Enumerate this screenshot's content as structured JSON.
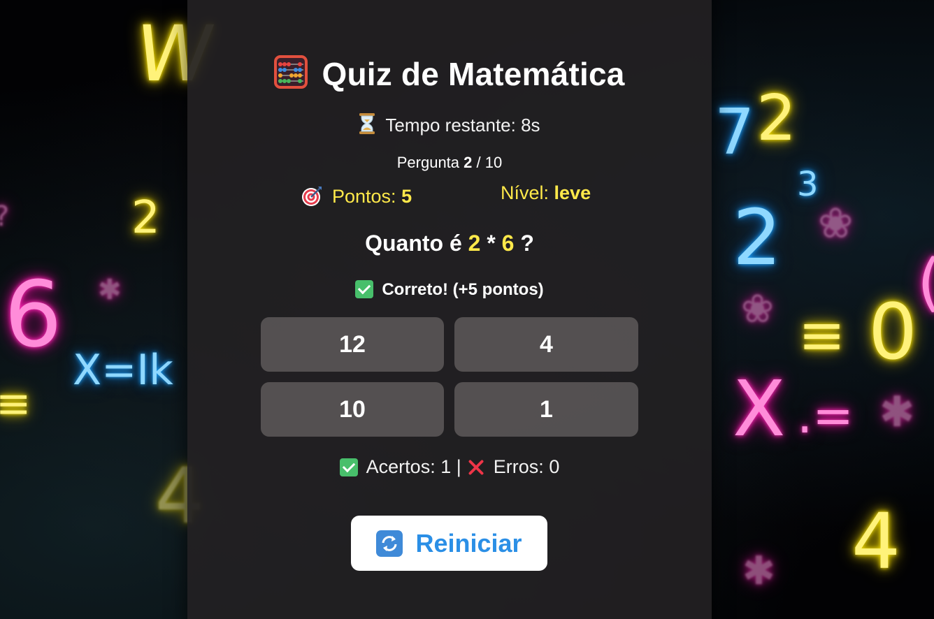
{
  "quiz": {
    "title": "Quiz de Matemática",
    "timer": {
      "label": "Tempo restante:",
      "value": "8s"
    },
    "progress": {
      "label": "Pergunta",
      "current": "2",
      "separator": "/",
      "total": "10"
    },
    "score": {
      "label": "Pontos:",
      "value": "5"
    },
    "level": {
      "label": "Nível:",
      "value": "leve"
    },
    "question": {
      "prefix": "Quanto é",
      "operand_a": "2",
      "operator": "*",
      "operand_b": "6",
      "suffix": "?"
    },
    "feedback": "Correto! (+5 pontos)",
    "answers": [
      "12",
      "4",
      "10",
      "1"
    ],
    "stats": {
      "hits_label": "Acertos:",
      "hits": "1",
      "separator": "|",
      "errors_label": "Erros:",
      "errors": "0"
    },
    "restart_label": "Reiniciar"
  },
  "icons": {
    "title": "abacus-icon",
    "timer": "hourglass-icon",
    "score": "target-icon",
    "feedback": "check-mark-icon",
    "hits": "check-mark-icon",
    "errors": "cross-mark-icon",
    "restart": "refresh-icon"
  },
  "colors": {
    "card_background": "#222022",
    "highlight": "#ffe94a",
    "answer_button": "#5f5c5c",
    "restart_text": "#2b8fe6",
    "check": "#48bf6b",
    "cross": "#ee3548"
  }
}
